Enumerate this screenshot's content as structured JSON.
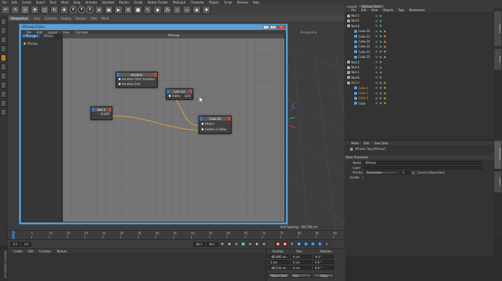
{
  "menubar": {
    "items": [
      "File",
      "Edit",
      "Create",
      "Select",
      "Tools",
      "Mesh",
      "Snap",
      "Animate",
      "Simulate",
      "Render",
      "Sculpt",
      "Motion Tracker",
      "MoGraph",
      "Character",
      "Plugins",
      "Script",
      "Window",
      "Help"
    ],
    "layout_label": "Layout:",
    "layout_value": "Startup (User)"
  },
  "toolbar": {
    "x_label": "X",
    "y_label": "Y",
    "z_label": "Z"
  },
  "viewport": {
    "tab_label": "Perspective",
    "menu": [
      "View",
      "Cameras",
      "Display",
      "Options",
      "Filter",
      "Panel"
    ],
    "corner_label": "Perspective"
  },
  "xpresso": {
    "title": "XPresso Editor",
    "menu": [
      "File",
      "Edit",
      "Layout",
      "View",
      "Calculate"
    ],
    "tabs": [
      "X-Manager",
      "XPools"
    ],
    "group_list_label": "XGroup",
    "group_header": "XGroup",
    "grid_status": "Grid Spacing : 355.700 cm",
    "nodes": {
      "iteration": {
        "title": "Iteration",
        "ports_in": [
          "Iteration Start",
          "Iteration End"
        ],
        "port_out": "Iteration"
      },
      "linklist": {
        "title": "Link List",
        "port_in": "Index",
        "port_out": "Link"
      },
      "null": {
        "title": "Null.2",
        "port_out": "On/Off"
      },
      "cube": {
        "title": "Cube.26",
        "ports_in": [
          "Object",
          "Visible in Editor"
        ]
      }
    }
  },
  "objects": {
    "tabs": [
      "Objects",
      "Takes",
      "Content Browser",
      "Structure"
    ],
    "menu": [
      "File",
      "Edit",
      "View",
      "Objects",
      "Tags",
      "Bookmarks"
    ],
    "rows": [
      {
        "name": "Null.1",
        "indent": 0
      },
      {
        "name": "Null.5",
        "indent": 0
      },
      {
        "name": "Null.6",
        "indent": 0
      },
      {
        "name": "Cube.20",
        "indent": 1
      },
      {
        "name": "Cube.23",
        "indent": 1
      },
      {
        "name": "Cube.24",
        "indent": 1
      },
      {
        "name": "Cube.22",
        "indent": 1
      },
      {
        "name": "Cube.21",
        "indent": 1
      },
      {
        "name": "Cube.25",
        "indent": 1
      },
      {
        "name": "Null.3",
        "indent": 0
      },
      {
        "name": "Null.4",
        "indent": 0
      },
      {
        "name": "Null.1",
        "indent": 0
      },
      {
        "name": "Null.8",
        "indent": 0
      },
      {
        "name": "Null.2",
        "indent": 0
      },
      {
        "name": "Cube.0",
        "indent": 1
      },
      {
        "name": "Cube.1",
        "indent": 1
      },
      {
        "name": "Cube.2",
        "indent": 1
      },
      {
        "name": "Cube",
        "indent": 1
      }
    ],
    "selected_row": "Null.2"
  },
  "attributes": {
    "menu": [
      "Mode",
      "Edit",
      "User Data"
    ],
    "tag_title": "XPresso Tag [XPresso]",
    "section": "Basic Properties",
    "name_label": "Name",
    "name_value": "XPresso",
    "layer_label": "Layer",
    "priority_label": "Priority",
    "priority_value": "Expression",
    "priority_num": "0",
    "camera_dependent": "Camera Dependent",
    "enable_label": "Enable",
    "enable_check": "✓"
  },
  "side_tabs": [
    "Attributes",
    "Layers",
    "Structure"
  ],
  "timeline": {
    "ticks": [
      "0",
      "5",
      "10",
      "15",
      "20",
      "25",
      "30",
      "35",
      "40",
      "45",
      "50",
      "55",
      "60",
      "65",
      "70",
      "75",
      "80",
      "85",
      "90"
    ],
    "start_frame": "0 F",
    "current_frame": "0 F",
    "end_frame": "90 F",
    "max_frame": "90 F"
  },
  "materials": {
    "menu": [
      "Create",
      "Edit",
      "Function",
      "Texture"
    ]
  },
  "coordinates": {
    "headers": [
      "Position",
      "Size",
      "Rotation"
    ],
    "rows": [
      {
        "axis": "X",
        "pos": "-86.085 cm",
        "size": "0 cm",
        "rot": "H 0 °"
      },
      {
        "axis": "Y",
        "pos": "0 cm",
        "size": "0 cm",
        "rot": "P 0 °"
      },
      {
        "axis": "Z",
        "pos": "-98.234 cm",
        "size": "0 cm",
        "rot": "B 0 °"
      }
    ],
    "mode": "Object (Rel)",
    "size_mode": "Size",
    "apply": "Apply"
  },
  "brand": "MAXON CINEMA 4D"
}
